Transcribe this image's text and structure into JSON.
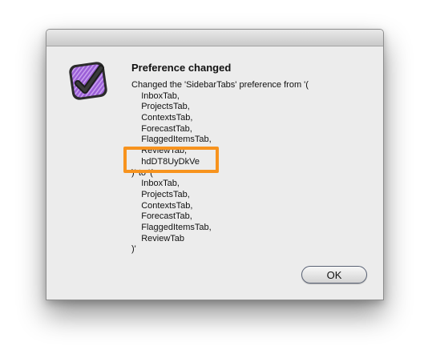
{
  "dialog": {
    "title": "Preference changed",
    "message_lines": [
      "Changed the 'SidebarTabs' preference from '(",
      "    InboxTab,",
      "    ProjectsTab,",
      "    ContextsTab,",
      "    ForecastTab,",
      "    FlaggedItemsTab,",
      "    ReviewTab,",
      "    hdDT8UyDkVe",
      ")' to '(",
      "    InboxTab,",
      "    ProjectsTab,",
      "    ContextsTab,",
      "    ForecastTab,",
      "    FlaggedItemsTab,",
      "    ReviewTab",
      ")'"
    ],
    "ok_label": "OK",
    "icon": "omnifocus-checkmark-icon"
  },
  "annotation": {
    "highlight_color": "#f7931e"
  },
  "colors": {
    "icon_purple": "#9b5fd6",
    "icon_dark": "#2b2b2b"
  }
}
